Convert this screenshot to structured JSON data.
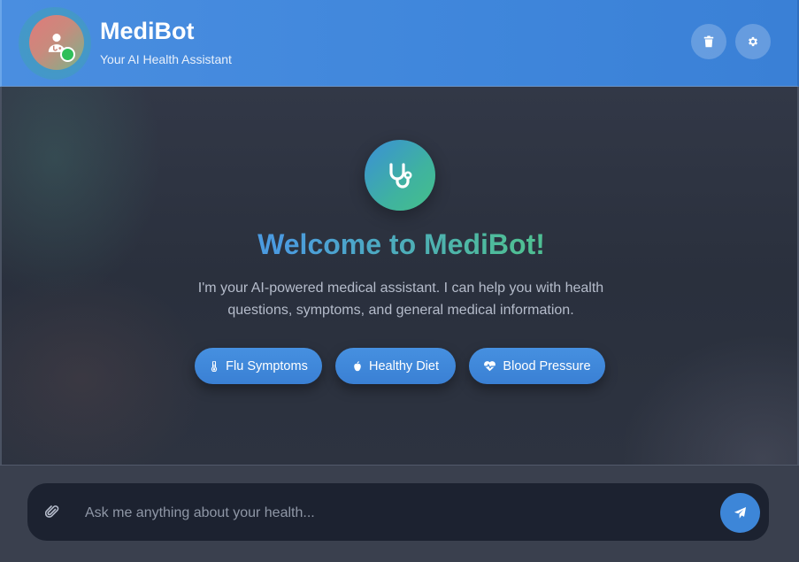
{
  "header": {
    "title": "MediBot",
    "subtitle": "Your AI Health Assistant",
    "avatar_icon": "user-doctor-icon",
    "status": "online",
    "actions": [
      {
        "name": "clear-chat",
        "icon": "trash-icon"
      },
      {
        "name": "settings",
        "icon": "gear-icon"
      }
    ]
  },
  "welcome": {
    "logo_icon": "stethoscope-icon",
    "heading": "Welcome to MediBot!",
    "intro": "I'm your AI-powered medical assistant. I can help you with health questions, symptoms, and general medical information."
  },
  "quick_prompts": [
    {
      "label": "Flu Symptoms",
      "icon": "thermometer-icon"
    },
    {
      "label": "Healthy Diet",
      "icon": "apple-icon"
    },
    {
      "label": "Blood Pressure",
      "icon": "heart-pulse-icon"
    }
  ],
  "composer": {
    "placeholder": "Ask me anything about your health...",
    "value": "",
    "attach_icon": "paperclip-icon",
    "send_icon": "paper-plane-icon"
  },
  "colors": {
    "header_blue": "#4a8ee0",
    "accent_teal": "#45c08a",
    "chip_blue": "#3d86d8",
    "background": "#2a303d",
    "online_green": "#2fbf5a"
  }
}
